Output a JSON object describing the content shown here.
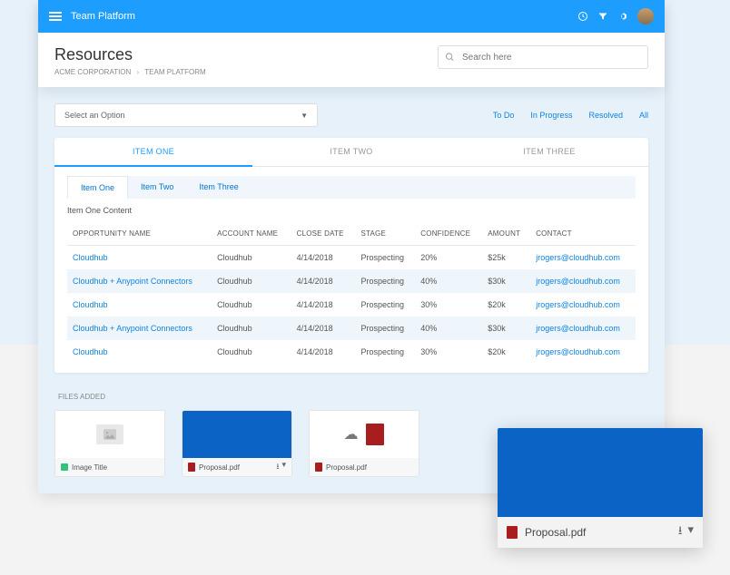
{
  "header": {
    "app_title": "Team Platform",
    "page_title": "Resources",
    "breadcrumb": [
      "ACME CORPORATION",
      "TEAM PLATFORM"
    ],
    "search_placeholder": "Search here"
  },
  "select": {
    "label": "Select an Option"
  },
  "status_filters": [
    "To Do",
    "In Progress",
    "Resolved",
    "All"
  ],
  "big_tabs": [
    "ITEM ONE",
    "ITEM TWO",
    "ITEM THREE"
  ],
  "sub_tabs": [
    "Item One",
    "Item Two",
    "Item Three"
  ],
  "sub_content_label": "Item One Content",
  "table": {
    "headers": [
      "OPPORTUNITY NAME",
      "ACCOUNT NAME",
      "CLOSE DATE",
      "STAGE",
      "CONFIDENCE",
      "AMOUNT",
      "CONTACT"
    ],
    "rows": [
      {
        "opp": "Cloudhub",
        "acct": "Cloudhub",
        "date": "4/14/2018",
        "stage": "Prospecting",
        "conf": "20%",
        "amt": "$25k",
        "contact": "jrogers@cloudhub.com"
      },
      {
        "opp": "Cloudhub + Anypoint Connectors",
        "acct": "Cloudhub",
        "date": "4/14/2018",
        "stage": "Prospecting",
        "conf": "40%",
        "amt": "$30k",
        "contact": "jrogers@cloudhub.com"
      },
      {
        "opp": "Cloudhub",
        "acct": "Cloudhub",
        "date": "4/14/2018",
        "stage": "Prospecting",
        "conf": "30%",
        "amt": "$20k",
        "contact": "jrogers@cloudhub.com"
      },
      {
        "opp": "Cloudhub + Anypoint Connectors",
        "acct": "Cloudhub",
        "date": "4/14/2018",
        "stage": "Prospecting",
        "conf": "40%",
        "amt": "$30k",
        "contact": "jrogers@cloudhub.com"
      },
      {
        "opp": "Cloudhub",
        "acct": "Cloudhub",
        "date": "4/14/2018",
        "stage": "Prospecting",
        "conf": "30%",
        "amt": "$20k",
        "contact": "jrogers@cloudhub.com"
      }
    ]
  },
  "files_label": "FILES ADDED",
  "files": [
    {
      "title": "Image Title",
      "type": "image"
    },
    {
      "title": "Proposal.pdf",
      "type": "pdf-blue"
    },
    {
      "title": "Proposal.pdf",
      "type": "pdf-cloud"
    }
  ],
  "popup": {
    "name": "Proposal.pdf"
  }
}
